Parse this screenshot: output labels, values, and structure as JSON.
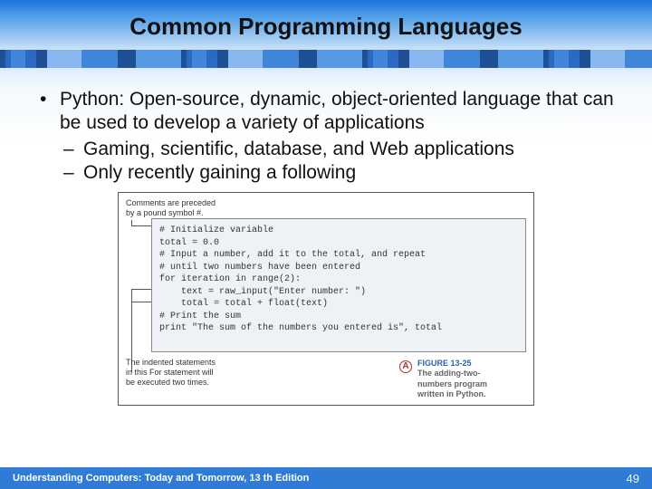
{
  "title": "Common Programming Languages",
  "bullets": {
    "main": "Python: Open-source, dynamic, object-oriented language that can be used to develop a variety of applications",
    "sub1": "Gaming, scientific, database, and Web applications",
    "sub2": "Only recently gaining a following"
  },
  "figure": {
    "callout_top_l1": "Comments are preceded",
    "callout_top_l2": "by a pound symbol #.",
    "code": {
      "c1": "# Initialize variable",
      "c2": "total = 0.0",
      "c3": "",
      "c4": "# Input a number, add it to the total, and repeat",
      "c5": "# until two numbers have been entered",
      "c6": "for iteration in range(2):",
      "c7": "    text = raw_input(\"Enter number: \")",
      "c8": "    total = total + float(text)",
      "c9": "",
      "c10": "# Print the sum",
      "c11": "print \"The sum of the numbers you entered is\", total"
    },
    "callout_bot_l1": "The indented statements",
    "callout_bot_l2": "in this For statement will",
    "callout_bot_l3": "be executed two times.",
    "label_icon": "A",
    "label_num": "FIGURE 13-25",
    "label_desc_l1": "The adding-two-",
    "label_desc_l2": "numbers program",
    "label_desc_l3": "written in Python."
  },
  "footer": {
    "book": "Understanding Computers: Today and Tomorrow, 13 th Edition",
    "page": "49"
  }
}
